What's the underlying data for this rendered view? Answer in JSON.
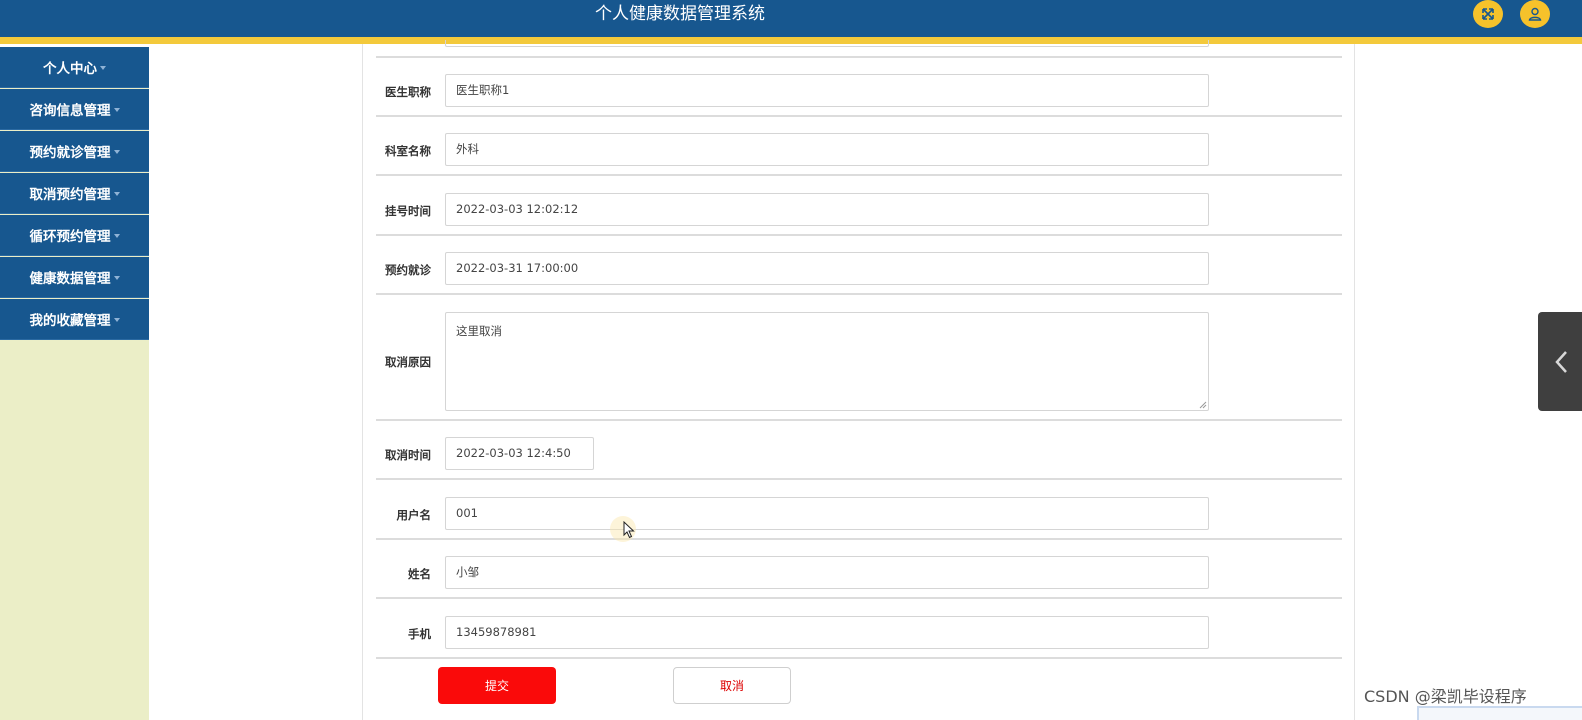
{
  "header": {
    "title": "个人健康数据管理系统",
    "colors": {
      "primary": "#17578f",
      "accent": "#f3c93b",
      "icon_button": "#f6c22b"
    },
    "buttons": [
      {
        "icon": "fullscreen-icon"
      },
      {
        "icon": "user-icon"
      }
    ]
  },
  "sidebar": {
    "background": "#ebeec7",
    "items": [
      {
        "label": "个人中心"
      },
      {
        "label": "咨询信息管理"
      },
      {
        "label": "预约就诊管理"
      },
      {
        "label": "取消预约管理"
      },
      {
        "label": "循环预约管理"
      },
      {
        "label": "健康数据管理"
      },
      {
        "label": "我的收藏管理"
      }
    ]
  },
  "form": {
    "fields": [
      {
        "label": "医生职称",
        "value": "医生职称1"
      },
      {
        "label": "科室名称",
        "value": "外科"
      },
      {
        "label": "挂号时间",
        "value": "2022-03-03 12:02:12"
      },
      {
        "label": "预约就诊",
        "value": "2022-03-31 17:00:00"
      },
      {
        "label": "取消原因",
        "value": "这里取消"
      },
      {
        "label": "取消时间",
        "value": "2022-03-03 12:4:50"
      },
      {
        "label": "用户名",
        "value": "001"
      },
      {
        "label": "姓名",
        "value": "小邹"
      },
      {
        "label": "手机",
        "value": "13459878981"
      }
    ],
    "submit_label": "提交",
    "cancel_label": "取消",
    "submit_color": "#fa0a0a"
  },
  "watermark": "CSDN @梁凯毕设程序"
}
